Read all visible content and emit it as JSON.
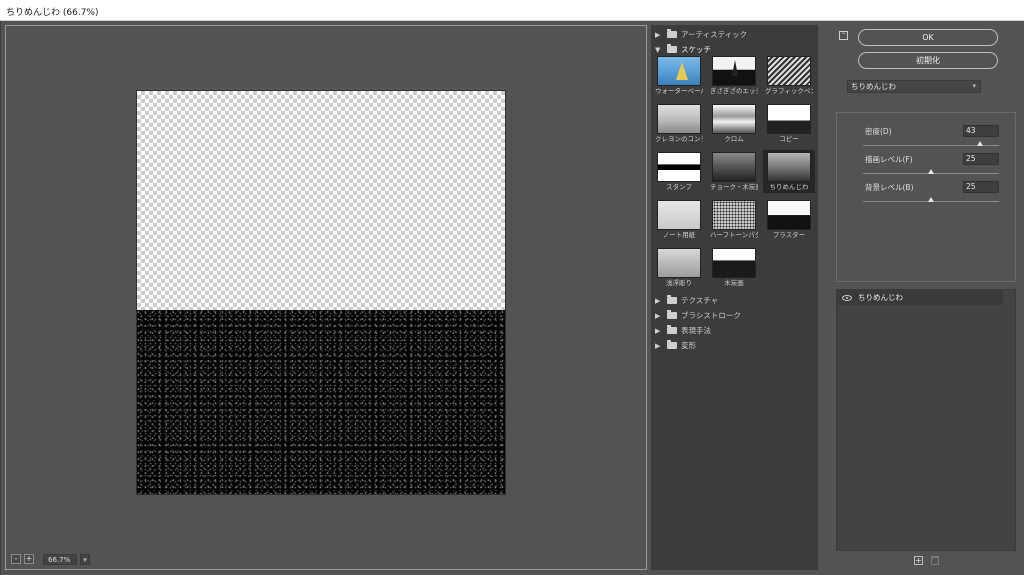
{
  "window": {
    "title": "ちりめんじわ (66.7%)"
  },
  "preview": {
    "zoom": "66.7%",
    "zoom_out": "-",
    "zoom_in": "+"
  },
  "gallery": {
    "categories": [
      {
        "label": "アーティスティック",
        "open": false
      },
      {
        "label": "スケッチ",
        "open": true
      },
      {
        "label": "テクスチャ",
        "open": false
      },
      {
        "label": "ブラシストローク",
        "open": false
      },
      {
        "label": "表現手法",
        "open": false
      },
      {
        "label": "変形",
        "open": false
      }
    ],
    "sketch_filters": [
      {
        "label": "ウォーターペーパー",
        "style": "water"
      },
      {
        "label": "ぎざぎざのエッジ",
        "style": "bw"
      },
      {
        "label": "グラフィックペン",
        "style": "sketch"
      },
      {
        "label": "クレヨンのコンテ画",
        "style": "gray"
      },
      {
        "label": "クロム",
        "style": "chrome"
      },
      {
        "label": "コピー",
        "style": "copy"
      },
      {
        "label": "スタンプ",
        "style": "stamp"
      },
      {
        "label": "チョーク・木炭画",
        "style": "chalk"
      },
      {
        "label": "ちりめんじわ",
        "style": "reticul",
        "selected": true
      },
      {
        "label": "ノート用紙",
        "style": "note"
      },
      {
        "label": "ハーフトーンパターン",
        "style": "halftone"
      },
      {
        "label": "プラスター",
        "style": "plaster"
      },
      {
        "label": "浅浮彫り",
        "style": "bas"
      },
      {
        "label": "木炭画",
        "style": "charcoal"
      }
    ]
  },
  "settings": {
    "ok_label": "OK",
    "reset_label": "初期化",
    "filter_select": "ちりめんじわ",
    "params": [
      {
        "label": "密度(D)",
        "value": "43",
        "fraction": 0.86
      },
      {
        "label": "描画レベル(F)",
        "value": "25",
        "fraction": 0.5
      },
      {
        "label": "背景レベル(B)",
        "value": "25",
        "fraction": 0.5
      }
    ]
  },
  "layers": [
    {
      "label": "ちりめんじわ"
    }
  ]
}
